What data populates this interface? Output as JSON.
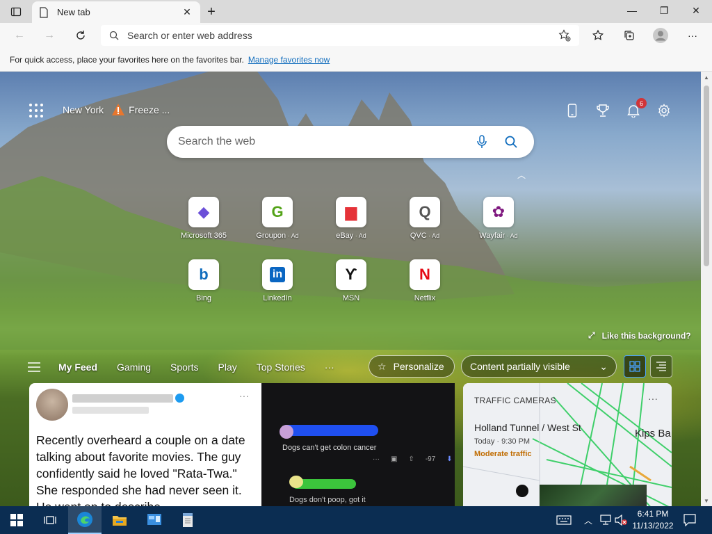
{
  "browser": {
    "tab_title": "New tab",
    "address_placeholder": "Search or enter web address",
    "favorites_bar_text": "For quick access, place your favorites here on the favorites bar.",
    "favorites_bar_link": "Manage favorites now"
  },
  "ntp": {
    "location": "New York",
    "weather": "Freeze ...",
    "notification_count": "6",
    "search_placeholder": "Search the web",
    "quick_links": [
      {
        "label": "Microsoft 365",
        "ad": "",
        "icon": "microsoft365-icon",
        "glyph": "◆",
        "color": "#6b4fd8"
      },
      {
        "label": "Groupon",
        "ad": "· Ad",
        "icon": "groupon-icon",
        "glyph": "G",
        "color": "#53a318"
      },
      {
        "label": "eBay",
        "ad": "· Ad",
        "icon": "ebay-bag-icon",
        "glyph": "▆",
        "color": "#e53238"
      },
      {
        "label": "QVC",
        "ad": "· Ad",
        "icon": "qvc-icon",
        "glyph": "Q",
        "color": "#555555"
      },
      {
        "label": "Wayfair",
        "ad": "· Ad",
        "icon": "wayfair-icon",
        "glyph": "✿",
        "color": "#7f187f"
      },
      {
        "label": "Bing",
        "ad": "",
        "icon": "bing-icon",
        "glyph": "b",
        "color": "#0f6cbd"
      },
      {
        "label": "LinkedIn",
        "ad": "",
        "icon": "linkedin-icon",
        "glyph": "in",
        "color": "#ffffff"
      },
      {
        "label": "MSN",
        "ad": "",
        "icon": "msn-icon",
        "glyph": "ϒ",
        "color": "#111111"
      },
      {
        "label": "Netflix",
        "ad": "",
        "icon": "netflix-icon",
        "glyph": "N",
        "color": "#e50914"
      }
    ],
    "like_background": "Like this background?"
  },
  "feed": {
    "nav_items": [
      "My Feed",
      "Gaming",
      "Sports",
      "Play",
      "Top Stories"
    ],
    "more": "···",
    "personalize": "Personalize",
    "content_visibility": "Content partially visible",
    "card1_text": "Recently overheard a couple on a date talking about favorite movies. The guy confidently said he loved \"Rata-Twa.\" She responded she had never seen it. He went on to describe",
    "card2_line1": "Dogs can't get colon cancer",
    "card2_votes": "-97",
    "card2_line2": "Dogs don't poop, got it",
    "traffic": {
      "header": "TRAFFIC CAMERAS",
      "location": "Holland Tunnel / West St",
      "time": "Today · 9:30 PM",
      "status": "Moderate traffic",
      "map_label": "Kips Ba"
    }
  },
  "taskbar": {
    "time": "6:41 PM",
    "date": "11/13/2022"
  },
  "colors": {
    "accent": "#0f6cbd",
    "taskbar": "#0b2d52",
    "traffic_moderate": "#c06c00"
  }
}
